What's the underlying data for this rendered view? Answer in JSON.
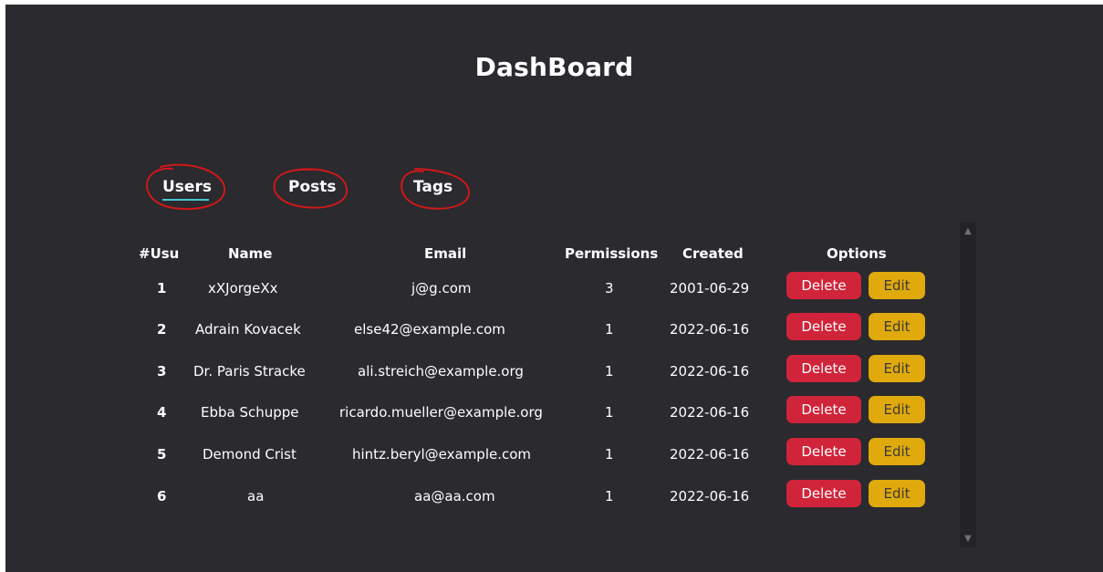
{
  "header": {
    "title": "DashBoard"
  },
  "tabs": [
    {
      "label": "Users",
      "active": true
    },
    {
      "label": "Posts",
      "active": false
    },
    {
      "label": "Tags",
      "active": false
    }
  ],
  "table": {
    "headers": [
      "#Usu",
      "Name",
      "Email",
      "Permissions",
      "Created",
      "Options"
    ],
    "rows": [
      {
        "id": "1",
        "name": "xXJorgeXx",
        "email": "j@g.com",
        "permissions": "3",
        "created": "2001-06-29"
      },
      {
        "id": "2",
        "name": "Adrain Kovacek",
        "email": "else42@example.com",
        "permissions": "1",
        "created": "2022-06-16"
      },
      {
        "id": "3",
        "name": "Dr. Paris Stracke",
        "email": "ali.streich@example.org",
        "permissions": "1",
        "created": "2022-06-16"
      },
      {
        "id": "4",
        "name": "Ebba Schuppe",
        "email": "ricardo.mueller@example.org",
        "permissions": "1",
        "created": "2022-06-16"
      },
      {
        "id": "5",
        "name": "Demond Crist",
        "email": "hintz.beryl@example.com",
        "permissions": "1",
        "created": "2022-06-16"
      },
      {
        "id": "6",
        "name": "aa",
        "email": "aa@aa.com",
        "permissions": "1",
        "created": "2022-06-16"
      }
    ],
    "delete_label": "Delete",
    "edit_label": "Edit"
  },
  "scrollbar": {
    "up_icon": "chevron-up-icon",
    "down_icon": "chevron-down-icon"
  },
  "colors": {
    "background": "#2a2a2f",
    "delete": "#d0243a",
    "edit": "#e0a90c",
    "active_tab_underline": "#46c6d2",
    "annotation": "#d01818"
  }
}
